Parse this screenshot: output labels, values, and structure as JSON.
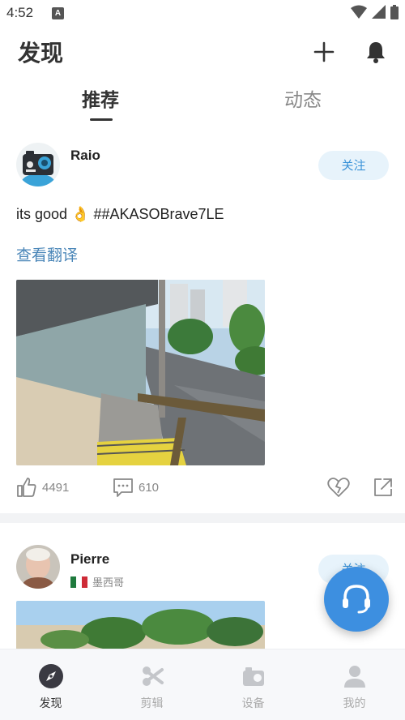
{
  "status_bar": {
    "time": "4:52",
    "notif_glyph": "A"
  },
  "header": {
    "title": "发现"
  },
  "tabs": [
    {
      "label": "推荐",
      "active": true
    },
    {
      "label": "动态",
      "active": false
    }
  ],
  "posts": [
    {
      "username": "Raio",
      "follow_label": "关注",
      "text": "its good 👌 ##AKASOBrave7LE",
      "translate_label": "查看翻译",
      "likes": "4491",
      "comments": "610"
    },
    {
      "username": "Pierre",
      "follow_label": "关注",
      "location": "墨西哥"
    }
  ],
  "bottom_nav": [
    {
      "label": "发现",
      "icon": "compass-icon",
      "active": true
    },
    {
      "label": "剪辑",
      "icon": "scissors-icon",
      "active": false
    },
    {
      "label": "设备",
      "icon": "camera-device-icon",
      "active": false
    },
    {
      "label": "我的",
      "icon": "person-icon",
      "active": false
    }
  ],
  "colors": {
    "accent": "#3d8fe0",
    "follow_bg": "#e7f3fb",
    "follow_text": "#3b93d8",
    "link": "#4a86b8"
  }
}
